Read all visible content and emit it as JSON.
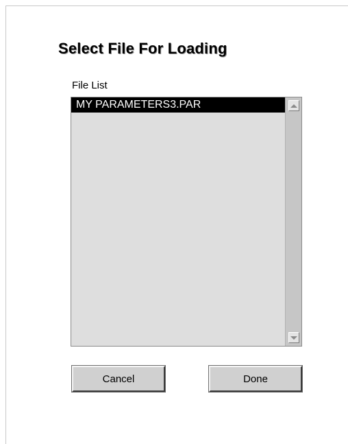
{
  "dialog": {
    "title": "Select File For Loading",
    "list_label": "File List",
    "files": [
      "MY PARAMETERS3.PAR"
    ],
    "selected_file": "MY PARAMETERS3.PAR",
    "cancel_label": "Cancel",
    "done_label": "Done"
  },
  "icons": {
    "scroll_up": "arrow-up-icon",
    "scroll_down": "arrow-down-icon"
  },
  "colors": {
    "selection_background": "#000000",
    "selection_text": "#ffffff",
    "list_background": "#dedede"
  }
}
